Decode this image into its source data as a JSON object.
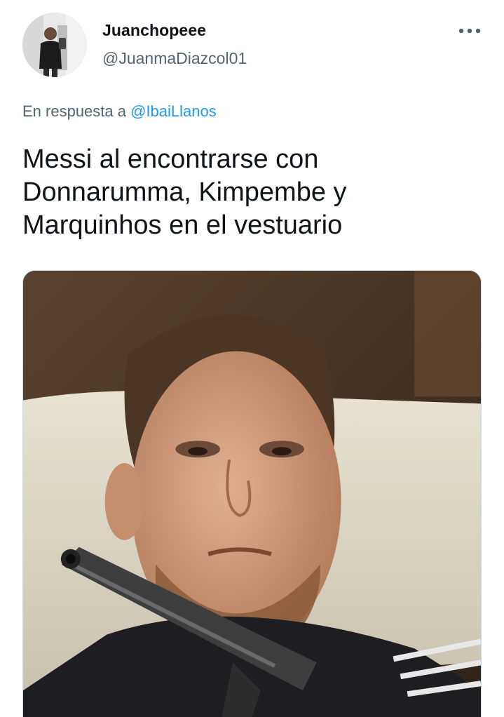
{
  "author": {
    "display_name": "Juanchopeee",
    "handle": "@JuanmaDiazcol01",
    "avatar_icon": "profile-photo"
  },
  "menu": {
    "icon": "more-horizontal-icon"
  },
  "reply": {
    "prefix": "En respuesta a",
    "mention": "@IbaiLlanos"
  },
  "tweet": {
    "text": "Messi al encontrarse con Donnarumma, Kimpembe y Marquinhos en el vestuario"
  },
  "colors": {
    "link": "#1d9bf0",
    "secondary_text": "#536471",
    "primary_text": "#0f1419",
    "border": "#cfd9de"
  }
}
